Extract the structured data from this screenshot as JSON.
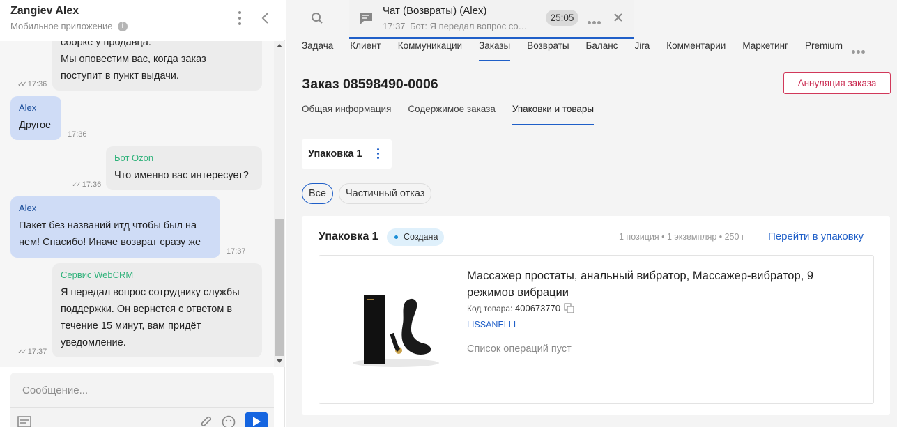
{
  "chat": {
    "contact_name": "Zangiev Alex",
    "contact_source": "Мобильное приложение",
    "messages": [
      {
        "type": "bot",
        "lines": [
          "сборке у продавца.",
          "Мы оповестим вас, когда заказ",
          "поступит в пункт выдачи."
        ],
        "time": "17:36"
      },
      {
        "type": "user",
        "sender": "Alex",
        "text": "Другое",
        "time": "17:36"
      },
      {
        "type": "bot",
        "sender": "Бот Ozon",
        "text": "Что именно вас интересует?",
        "time": "17:36"
      },
      {
        "type": "user",
        "sender": "Alex",
        "lines": [
          "Пакет без названий итд чтобы был на",
          "нем! Спасибо! Иначе возврат сразу же"
        ],
        "time": "17:37"
      },
      {
        "type": "bot",
        "sender": "Сервис WebCRM",
        "lines": [
          "Я передал вопрос сотруднику службы",
          "поддержки. Он вернется с ответом в",
          "течение 15 минут, вам придёт",
          "уведомление."
        ],
        "time": "17:37"
      }
    ],
    "composer_placeholder": "Сообщение..."
  },
  "chat_widget": {
    "title": "Чат (Возвраты) (Alex)",
    "time": "17:37",
    "preview": "Бот: Я передал вопрос сотрудни...",
    "timer": "25:05"
  },
  "top_tabs": [
    "Задача",
    "Клиент",
    "Коммуникации",
    "Заказы",
    "Возвраты",
    "Баланс",
    "Jira",
    "Комментарии",
    "Маркетинг",
    "Premium"
  ],
  "top_tabs_active": "Заказы",
  "order": {
    "title": "Заказ 08598490-0006",
    "cancel_button": "Аннуляция заказа",
    "sub_tabs": [
      "Общая информация",
      "Содержимое заказа",
      "Упаковки и товары"
    ],
    "sub_tab_active": "Упаковки и товары"
  },
  "package_chip": "Упаковка 1",
  "filters": [
    "Все",
    "Частичный отказ"
  ],
  "package_card": {
    "title": "Упаковка 1",
    "status": "Создана",
    "meta": "1 позиция • 1 экземпляр • 250 г",
    "goto_link": "Перейти в упаковку",
    "product": {
      "name": "Массажер простаты, анальный вибратор, Массажер-вибратор, 9 режимов вибрации",
      "code_label": "Код товара:",
      "code": "400673770",
      "brand": "LISSANELLI",
      "operations": "Список операций пуст"
    }
  },
  "colors": {
    "accent": "#1f5fc8",
    "danger": "#c92a50",
    "user_bubble": "#cfdcf6",
    "bot_bubble": "#ececec",
    "status_badge": "#dff0fb"
  }
}
